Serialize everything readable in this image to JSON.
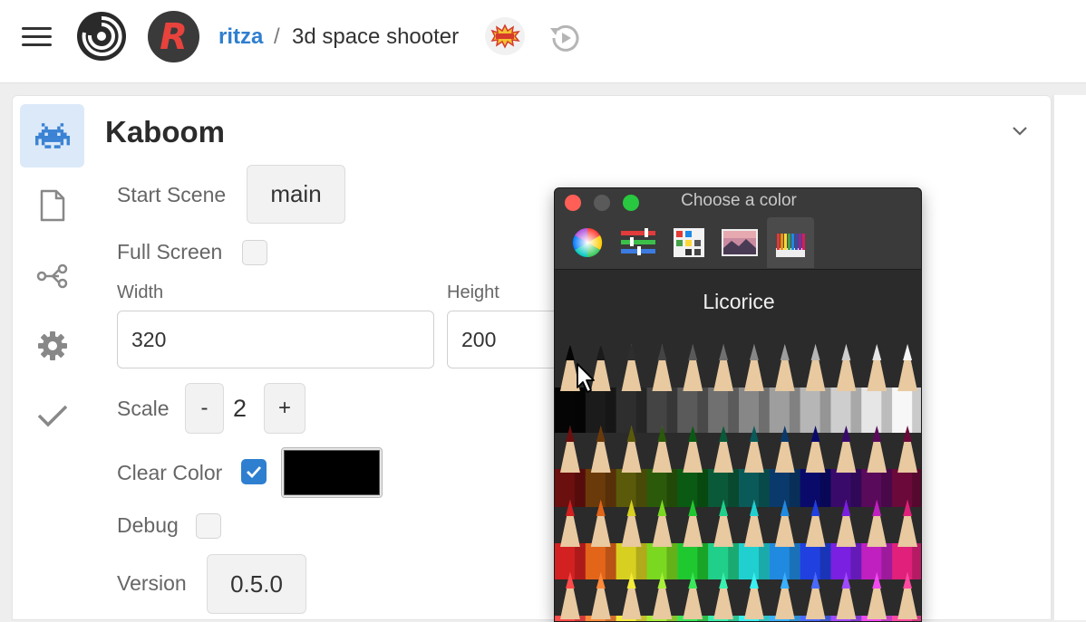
{
  "topbar": {
    "owner": "ritza",
    "separator": "/",
    "project": "3d space shooter",
    "avatar_letter": "R",
    "icons": [
      "hamburger-menu-icon",
      "replit-logo-icon",
      "kaboom-badge-icon",
      "history-icon"
    ]
  },
  "sidebar": {
    "items": [
      {
        "icon": "space-invader-icon",
        "active": true
      },
      {
        "icon": "file-icon",
        "active": false
      },
      {
        "icon": "share-icon",
        "active": false
      },
      {
        "icon": "gear-icon",
        "active": false
      },
      {
        "icon": "check-icon",
        "active": false
      }
    ]
  },
  "panel": {
    "title": "Kaboom",
    "start_scene_label": "Start Scene",
    "start_scene_value": "main",
    "full_screen_label": "Full Screen",
    "full_screen_checked": false,
    "width_label": "Width",
    "width_value": "320",
    "height_label": "Height",
    "height_value": "200",
    "scale_label": "Scale",
    "scale_minus": "-",
    "scale_value": "2",
    "scale_plus": "+",
    "clear_color_label": "Clear Color",
    "clear_color_checked": true,
    "clear_color_swatch": "#000000",
    "debug_label": "Debug",
    "debug_checked": false,
    "version_label": "Version",
    "version_value": "0.5.0"
  },
  "color_picker": {
    "window_title": "Choose a color",
    "selected_color_name": "Licorice",
    "tabs": [
      "color-wheel-icon",
      "color-sliders-icon",
      "color-palettes-icon",
      "image-palettes-icon",
      "pencils-icon"
    ],
    "active_tab": "pencils-icon",
    "traffic_lights": [
      "#ff5f57",
      "#5a5a5a",
      "#28c840"
    ]
  },
  "colors": {
    "accent": "#2f7fd0",
    "active_side_bg": "#dce9f8"
  }
}
